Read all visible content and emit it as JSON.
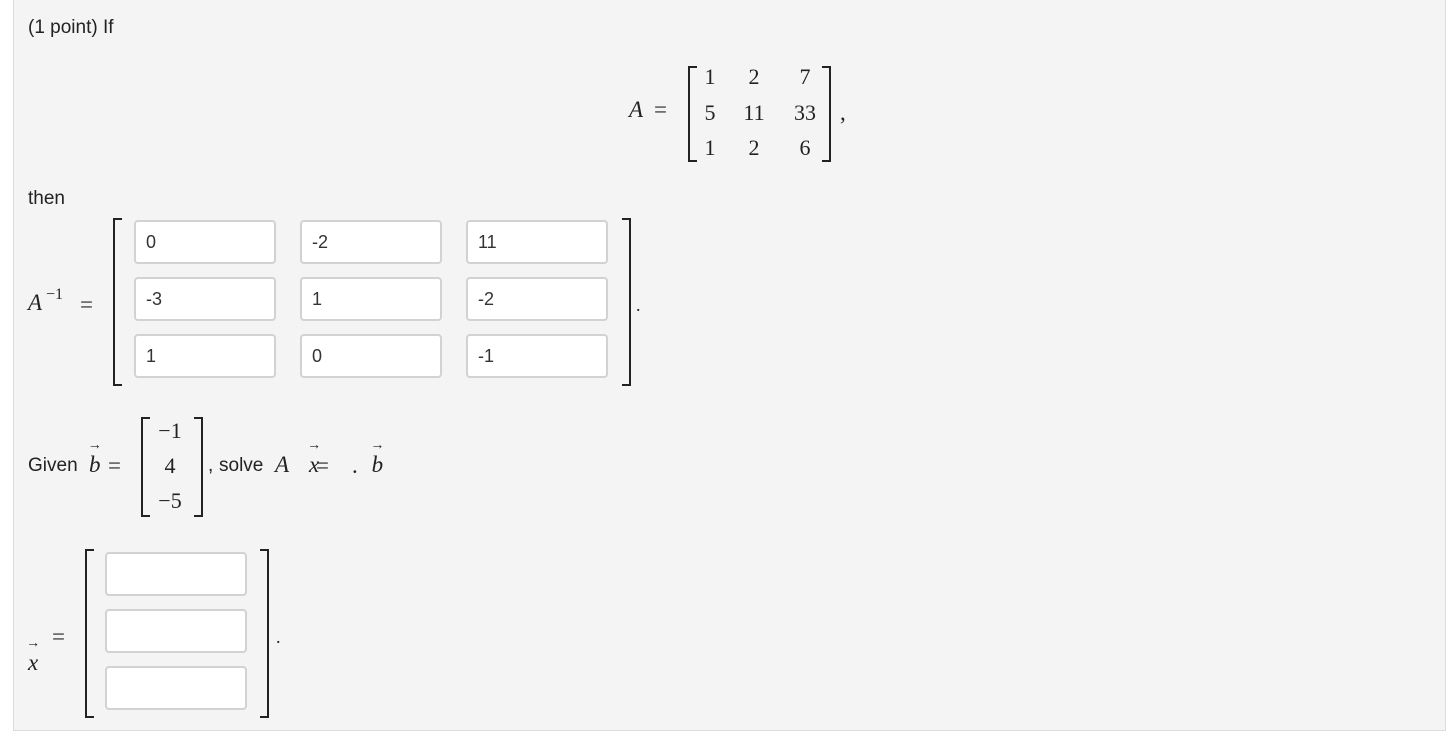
{
  "problem": {
    "intro": "(1 point) If",
    "then": "then",
    "matrix_A": {
      "symbol": "A",
      "eq": "=",
      "rows": [
        [
          "1",
          "2",
          "7"
        ],
        [
          "5",
          "11",
          "33"
        ],
        [
          "1",
          "2",
          "6"
        ]
      ],
      "trailing": ","
    },
    "inverse": {
      "symbol": "A",
      "sup": "−1",
      "eq": "=",
      "values": [
        [
          "0",
          "-2",
          "11"
        ],
        [
          "-3",
          "1",
          "-2"
        ],
        [
          "1",
          "0",
          "-1"
        ]
      ],
      "trailing": "."
    },
    "given": {
      "label": "Given",
      "b_symbol": "b",
      "eq": "=",
      "b_values": [
        "−1",
        "4",
        "−5"
      ],
      "comma": ",",
      "solve_label": "solve",
      "eq_A": "A",
      "eq_x": "x",
      "eq_sign": "=",
      "eq_b": "b",
      "period": "."
    },
    "solution": {
      "symbol": "x",
      "eq": "=",
      "values": [
        "",
        "",
        ""
      ],
      "trailing": "."
    }
  }
}
